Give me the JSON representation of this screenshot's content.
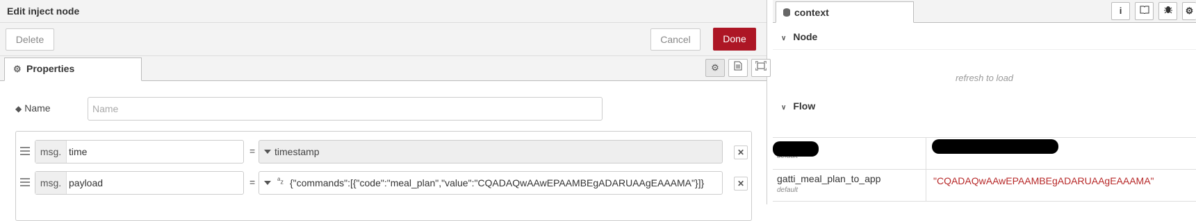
{
  "editor": {
    "title": "Edit inject node",
    "delete_label": "Delete",
    "cancel_label": "Cancel",
    "done_label": "Done",
    "tab_label": "Properties",
    "name_label": "Name",
    "name_placeholder": "Name",
    "rows": [
      {
        "prefix": "msg.",
        "field": "time",
        "type": "timestamp"
      },
      {
        "prefix": "msg.",
        "field": "payload",
        "type_glyph": "az",
        "value": "{\"commands\":[{\"code\":\"meal_plan\",\"value\":\"CQADAQwAAwEPAAMBEgADARUAAgEAAAMA\"}]}"
      }
    ]
  },
  "sidebar": {
    "tab_label": "context",
    "sections": {
      "node": {
        "title": "Node",
        "refresh": "refresh to load"
      },
      "flow": {
        "title": "Flow"
      }
    },
    "flow_rows": [
      {
        "key": "",
        "scope": "default",
        "value": ""
      },
      {
        "key": "gatti_meal_plan_to_app",
        "scope": "default",
        "value": "\"CQADAQwAAwEPAAMBEgADARUAAgEAAAMA\""
      }
    ]
  },
  "colors": {
    "done": "#ad1625",
    "value_text": "#b72828"
  }
}
